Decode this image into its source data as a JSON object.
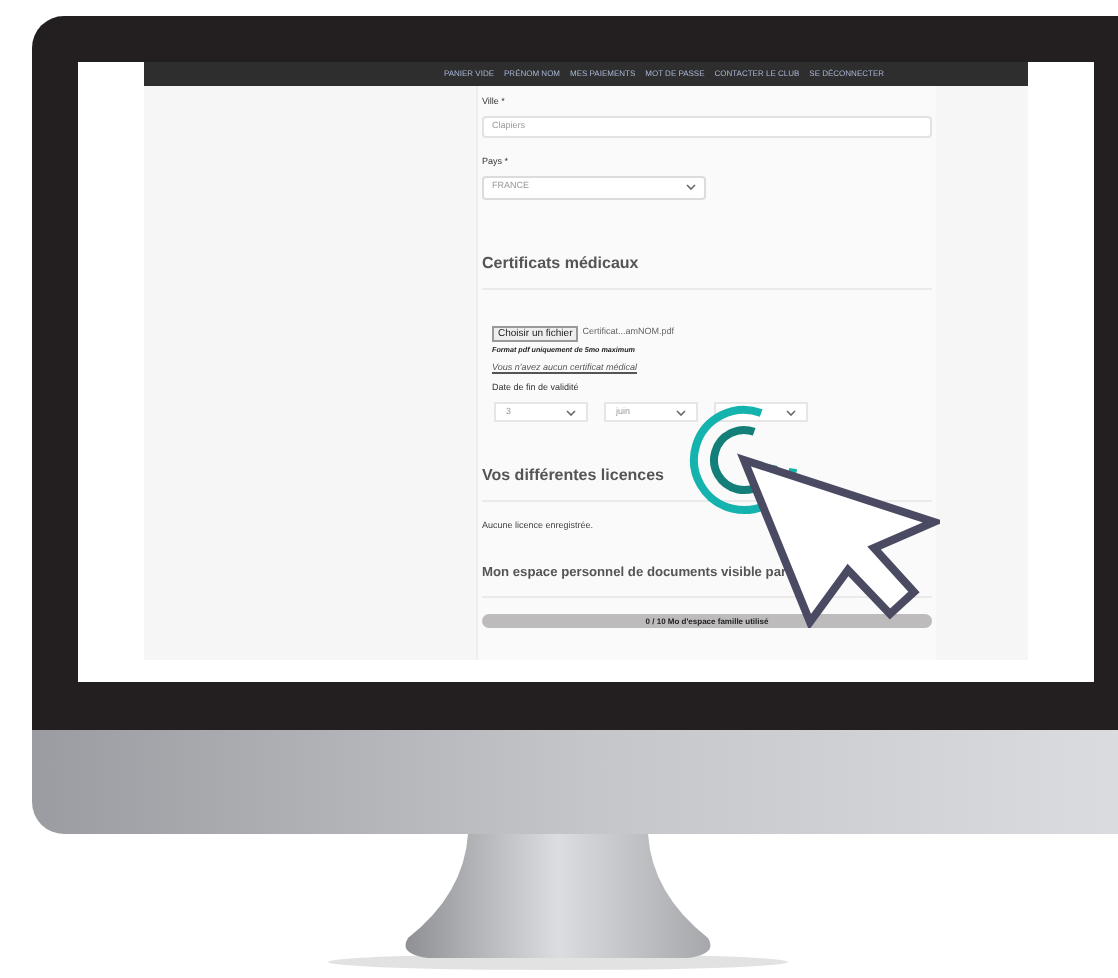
{
  "nav": {
    "items": [
      {
        "label": "PANIER VIDE"
      },
      {
        "label": "PRÉNOM NOM"
      },
      {
        "label": "MES PAIEMENTS"
      },
      {
        "label": "MOT DE PASSE"
      },
      {
        "label": "CONTACTER LE CLUB"
      },
      {
        "label": "SE DÉCONNECTER"
      }
    ]
  },
  "address": {
    "city_label": "Ville *",
    "city_value": "Clapiers",
    "country_label": "Pays *",
    "country_value": "FRANCE"
  },
  "certificates": {
    "heading": "Certificats médicaux",
    "file_button": "Choisir un fichier",
    "file_name": "Certificat...amNOM.pdf",
    "hint": "Format pdf uniquement de 5mo maximum",
    "link": "Vous n'avez aucun certificat médical",
    "date_label": "Date de fin de validité",
    "date_selects": [
      {
        "value": "3"
      },
      {
        "value": "juin"
      }
    ]
  },
  "licences": {
    "heading": "Vos différentes licences",
    "empty_text": "Aucune licence enregistrée."
  },
  "documents": {
    "heading": "Mon espace personnel de documents visible par",
    "storage": {
      "label": "0 / 10 Mo d'espace famille utilisé",
      "level": 0
    }
  }
}
